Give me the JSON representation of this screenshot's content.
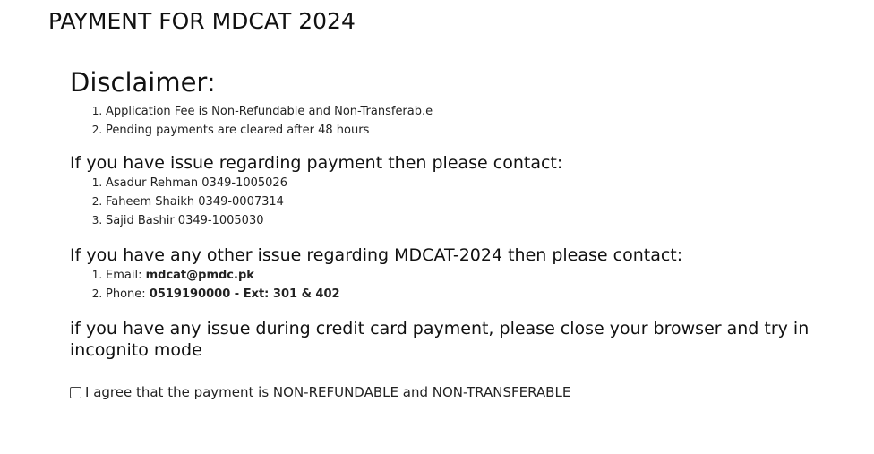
{
  "page": {
    "title": "PAYMENT FOR MDCAT 2024"
  },
  "disclaimer": {
    "heading": "Disclaimer:",
    "items": [
      "Application Fee is Non-Refundable and Non-Transferab.e",
      "Pending payments are cleared after 48 hours"
    ]
  },
  "payment_contacts": {
    "heading": "If you have issue regarding payment then please contact:",
    "items": [
      "Asadur Rehman 0349-1005026",
      "Faheem Shaikh 0349-0007314",
      "Sajid Bashir 0349-1005030"
    ]
  },
  "other_contacts": {
    "heading": "If you have any other issue regarding MDCAT-2024 then please contact:",
    "email_label": "Email: ",
    "email_value": "mdcat@pmdc.pk",
    "phone_label": "Phone: ",
    "phone_value": "0519190000 - Ext: 301 & 402"
  },
  "credit_card_note": "if you have any issue during credit card payment, please close your browser and try in incognito mode",
  "agreement": {
    "label": "I agree that the payment is NON-REFUNDABLE and NON-TRANSFERABLE",
    "checked": false
  }
}
